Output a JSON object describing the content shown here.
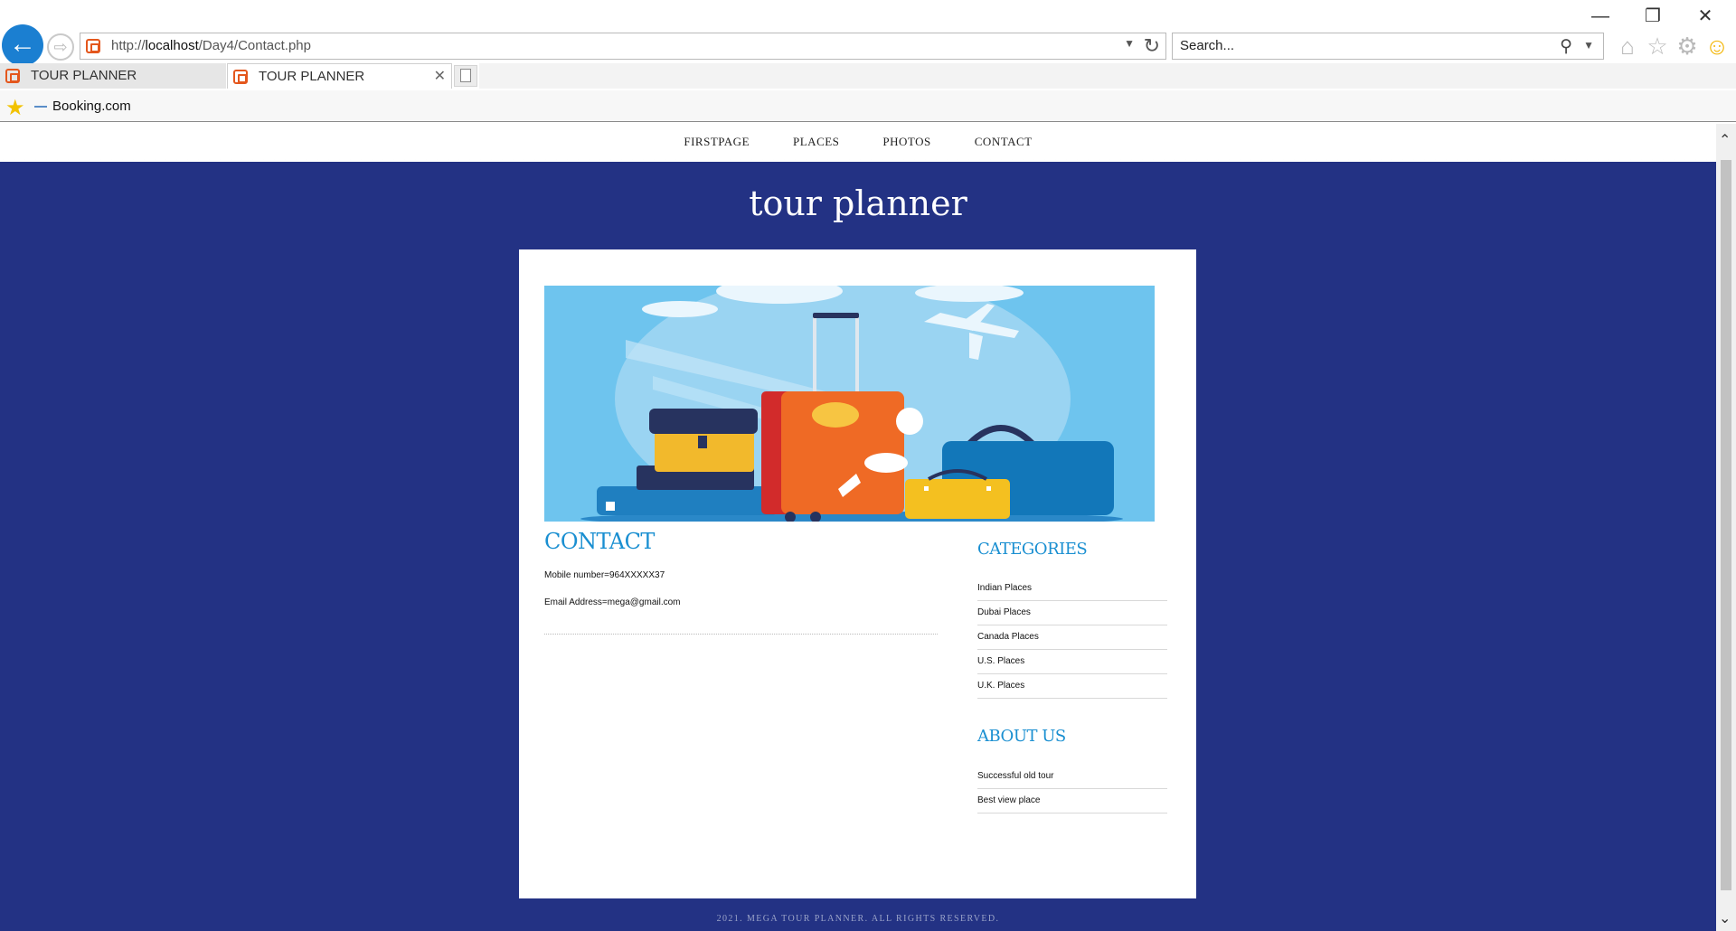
{
  "browser": {
    "address_prefix": "http://",
    "address_host": "localhost",
    "address_path": "/Day4/Contact.php",
    "search_placeholder": "Search...",
    "tabs": [
      {
        "label": "TOUR PLANNER"
      },
      {
        "label": "TOUR PLANNER"
      }
    ],
    "favorites": [
      {
        "label": "Booking.com"
      }
    ],
    "icons": {
      "back": "back-arrow-icon",
      "forward": "forward-arrow-icon",
      "refresh": "refresh-icon",
      "search": "search-icon",
      "home": "home-icon",
      "favorites": "star-icon",
      "settings": "gear-icon",
      "feedback": "smiley-icon"
    },
    "accent_color": "#1b7fd1"
  },
  "site": {
    "nav": [
      "FIRSTPAGE",
      "PLACES",
      "PHOTOS",
      "CONTACT"
    ],
    "title": "tour planner",
    "background_color": "#233284",
    "heading_color": "#1a8fd1",
    "contact": {
      "title": "CONTACT",
      "mobile": "Mobile number=964XXXXX37",
      "email": "Email Address=mega@gmail.com"
    },
    "categories": {
      "title": "CATEGORIES",
      "items": [
        "Indian Places",
        "Dubai Places",
        "Canada Places",
        "U.S. Places",
        "U.K. Places"
      ]
    },
    "about": {
      "title": "ABOUT US",
      "items": [
        "Successful old tour",
        "Best view place"
      ]
    },
    "footer": "2021. MEGA TOUR PLANNER. ALL RIGHTS RESERVED."
  }
}
